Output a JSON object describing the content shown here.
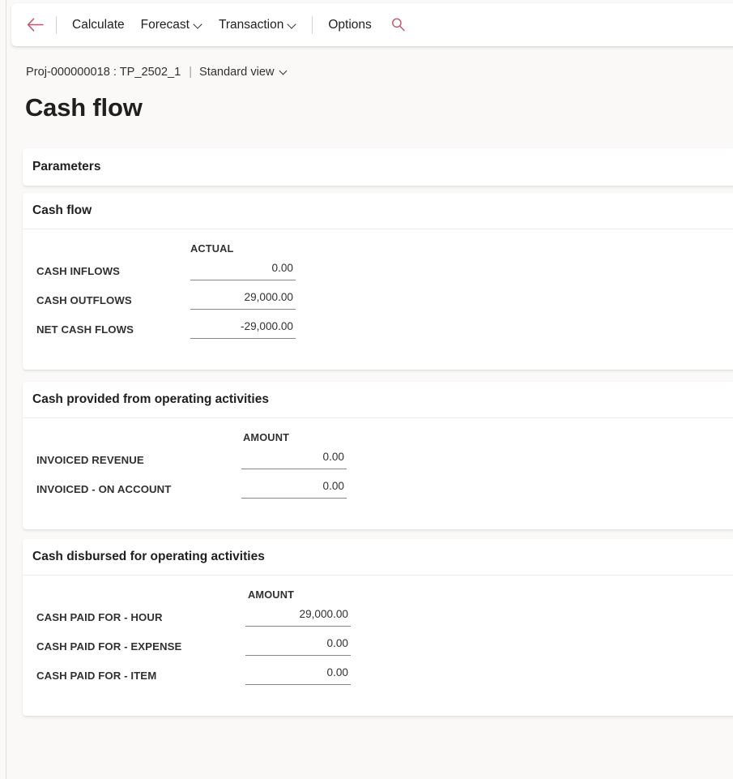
{
  "commandbar": {
    "back_icon": "back-arrow-icon",
    "search_icon": "search-icon",
    "items": [
      {
        "label": "Calculate",
        "has_caret": false
      },
      {
        "label": "Forecast",
        "has_caret": true
      },
      {
        "label": "Transaction",
        "has_caret": true
      },
      {
        "label": "Options",
        "has_caret": false
      }
    ]
  },
  "breadcrumb": {
    "record": "Proj-000000018 : TP_2502_1",
    "separator": "|",
    "view": "Standard view"
  },
  "page": {
    "title": "Cash flow"
  },
  "sections": {
    "parameters": {
      "title": "Parameters"
    },
    "cashflow": {
      "title": "Cash flow",
      "column_header": "ACTUAL",
      "rows": [
        {
          "label": "CASH INFLOWS",
          "value": "0.00"
        },
        {
          "label": "CASH OUTFLOWS",
          "value": "29,000.00"
        },
        {
          "label": "NET CASH FLOWS",
          "value": "-29,000.00"
        }
      ]
    },
    "provided": {
      "title": "Cash provided from operating activities",
      "column_header": "AMOUNT",
      "rows": [
        {
          "label": "INVOICED REVENUE",
          "value": "0.00"
        },
        {
          "label": "INVOICED - ON ACCOUNT",
          "value": "0.00"
        }
      ]
    },
    "disbursed": {
      "title": "Cash disbursed for operating activities",
      "column_header": "AMOUNT",
      "rows": [
        {
          "label": "CASH PAID FOR - HOUR",
          "value": "29,000.00"
        },
        {
          "label": "CASH PAID FOR - EXPENSE",
          "value": "0.00"
        },
        {
          "label": "CASH PAID FOR - ITEM",
          "value": "0.00"
        }
      ]
    }
  },
  "colors": {
    "accent": "#c4566e",
    "page_background": "#faf9f8",
    "card_background": "#ffffff",
    "text_primary": "#201f1e",
    "rule": "#8a8886"
  }
}
